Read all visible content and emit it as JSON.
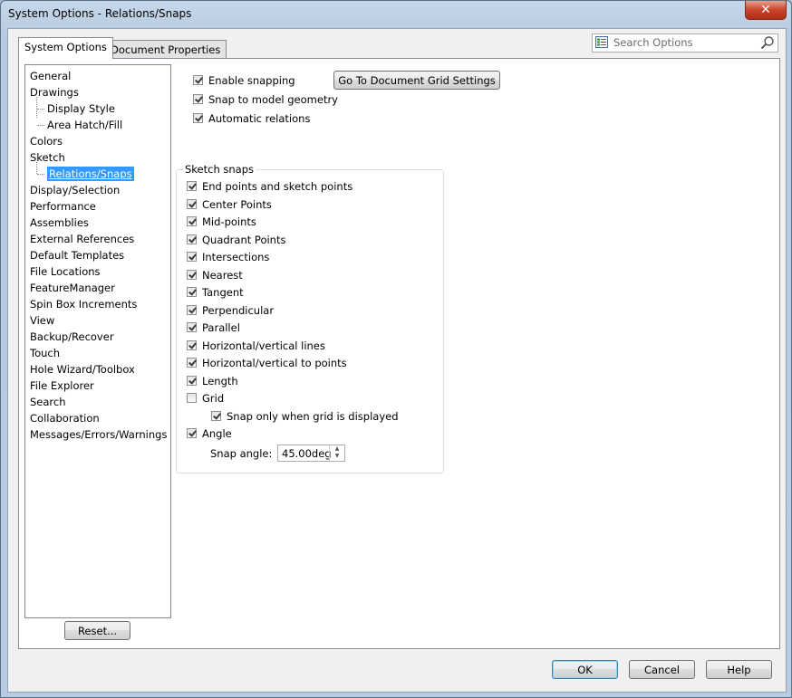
{
  "window": {
    "title": "System Options - Relations/Snaps",
    "close_glyph": "✕"
  },
  "tabs": [
    {
      "label": "System Options",
      "active": true
    },
    {
      "label": "Document Properties",
      "active": false
    }
  ],
  "search": {
    "placeholder": "Search Options",
    "icon": "options-list-icon",
    "search_icon": "magnifier-icon"
  },
  "tree": {
    "items": [
      {
        "label": "General"
      },
      {
        "label": "Drawings"
      },
      {
        "label": "Display Style"
      },
      {
        "label": "Area Hatch/Fill"
      },
      {
        "label": "Colors"
      },
      {
        "label": "Sketch"
      },
      {
        "label": "Relations/Snaps",
        "selected": true
      },
      {
        "label": "Display/Selection"
      },
      {
        "label": "Performance"
      },
      {
        "label": "Assemblies"
      },
      {
        "label": "External References"
      },
      {
        "label": "Default Templates"
      },
      {
        "label": "File Locations"
      },
      {
        "label": "FeatureManager"
      },
      {
        "label": "Spin Box Increments"
      },
      {
        "label": "View"
      },
      {
        "label": "Backup/Recover"
      },
      {
        "label": "Touch"
      },
      {
        "label": "Hole Wizard/Toolbox"
      },
      {
        "label": "File Explorer"
      },
      {
        "label": "Search"
      },
      {
        "label": "Collaboration"
      },
      {
        "label": "Messages/Errors/Warnings"
      }
    ]
  },
  "reset_label": "Reset...",
  "options": {
    "enable_snapping": {
      "label": "Enable snapping",
      "checked": true
    },
    "snap_model": {
      "label": "Snap to model geometry",
      "checked": true
    },
    "auto_relations": {
      "label": "Automatic relations",
      "checked": true
    },
    "grid_settings_button": "Go To Document Grid Settings"
  },
  "sketch_snaps": {
    "title": "Sketch snaps",
    "items": [
      {
        "label": "End points and sketch points",
        "checked": true
      },
      {
        "label": "Center Points",
        "checked": true
      },
      {
        "label": "Mid-points",
        "checked": true
      },
      {
        "label": "Quadrant Points",
        "checked": true
      },
      {
        "label": "Intersections",
        "checked": true
      },
      {
        "label": "Nearest",
        "checked": true
      },
      {
        "label": "Tangent",
        "checked": true
      },
      {
        "label": "Perpendicular",
        "checked": true
      },
      {
        "label": "Parallel",
        "checked": true
      },
      {
        "label": "Horizontal/vertical lines",
        "checked": true
      },
      {
        "label": "Horizontal/vertical to points",
        "checked": true
      },
      {
        "label": "Length",
        "checked": true
      },
      {
        "label": "Grid",
        "checked": false
      },
      {
        "label": "Snap only when grid is displayed",
        "checked": true
      },
      {
        "label": "Angle",
        "checked": true
      }
    ],
    "snap_angle_label": "Snap angle:",
    "snap_angle_value": "45.00deg"
  },
  "footer": {
    "ok": "OK",
    "cancel": "Cancel",
    "help": "Help"
  },
  "colors": {
    "selection": "#3399ff",
    "window_frame": "#b9cbe0",
    "close_button": "#c7432a"
  }
}
